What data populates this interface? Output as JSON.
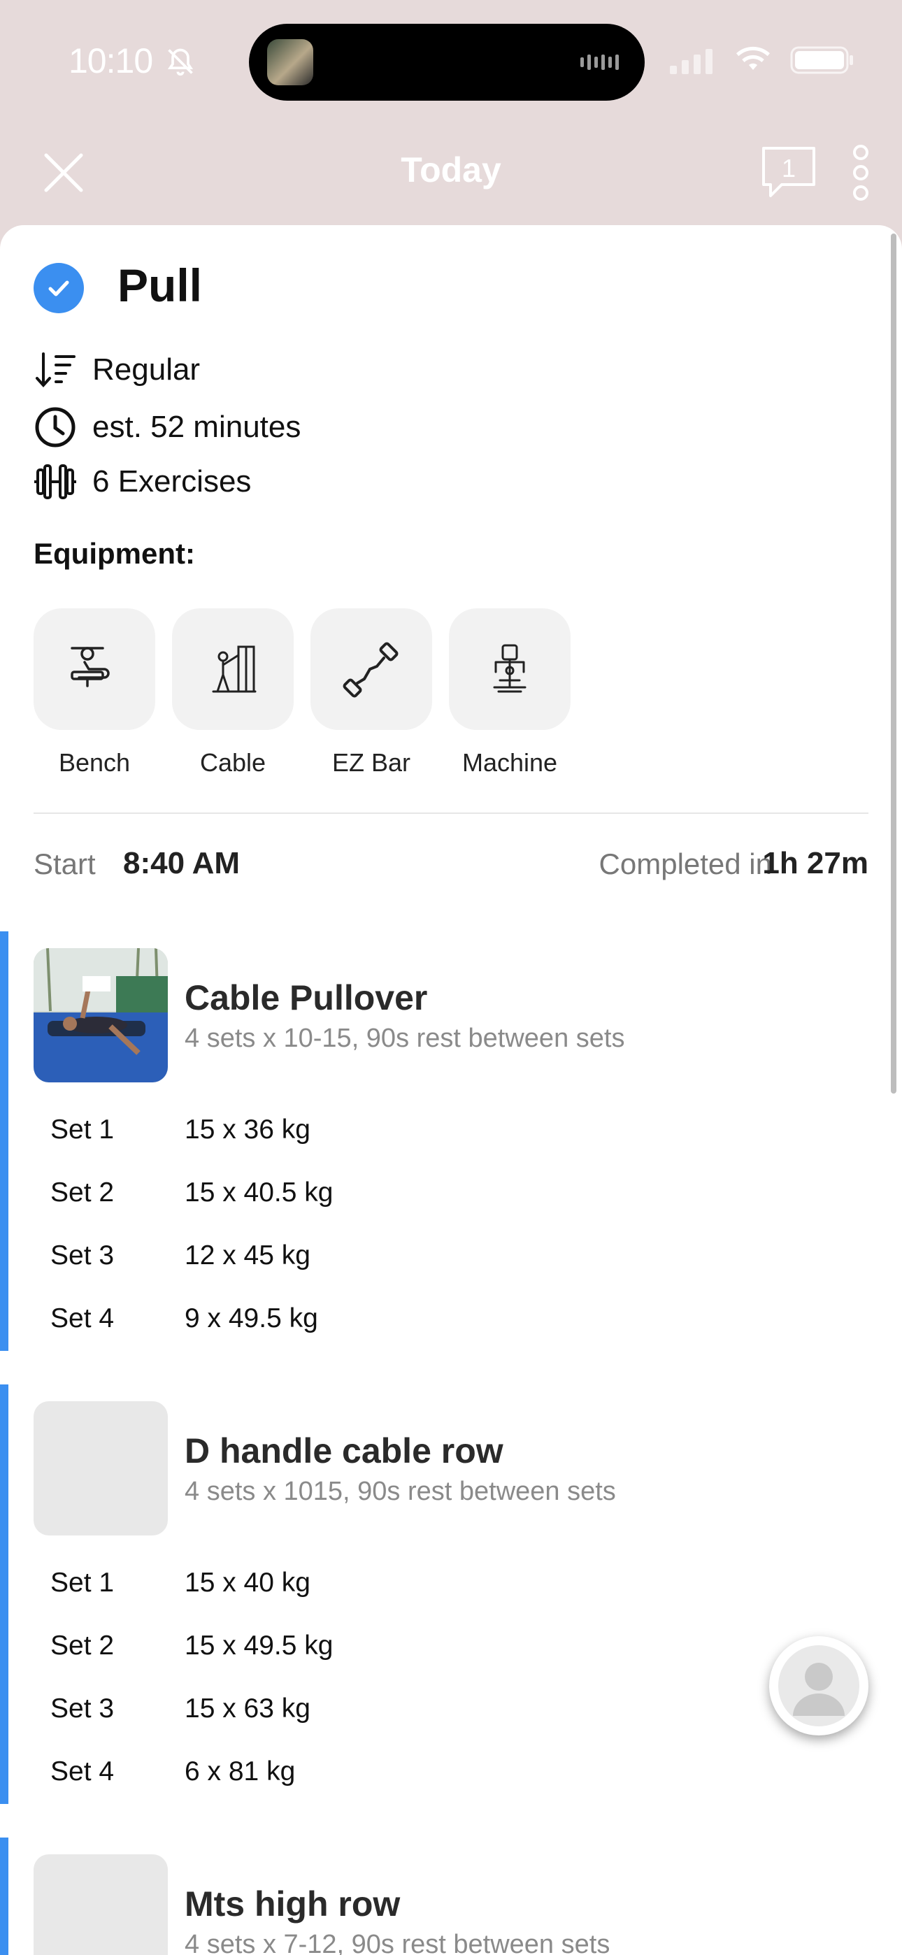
{
  "status_bar": {
    "time": "10:10"
  },
  "nav": {
    "title": "Today",
    "chat_count": "1"
  },
  "workout": {
    "title": "Pull",
    "meta": [
      {
        "icon": "sort-icon",
        "text": "Regular"
      },
      {
        "icon": "clock-icon",
        "text": "est. 52 minutes"
      },
      {
        "icon": "dumbbell-icon",
        "text": "6 Exercises"
      }
    ],
    "equipment_label": "Equipment:",
    "equipment": [
      {
        "icon": "bench-icon",
        "label": "Bench"
      },
      {
        "icon": "cable-icon",
        "label": "Cable"
      },
      {
        "icon": "ez-bar-icon",
        "label": "EZ Bar"
      },
      {
        "icon": "machine-icon",
        "label": "Machine"
      }
    ],
    "start_label": "Start",
    "start_time": "8:40 AM",
    "completed_label": "Completed in",
    "completed_time": "1h 27m"
  },
  "exercises": [
    {
      "name": "Cable Pullover",
      "summary": "4 sets x 10-15, 90s rest between sets",
      "sets": [
        {
          "label": "Set 1",
          "value": "15 x 36 kg"
        },
        {
          "label": "Set 2",
          "value": "15 x 40.5 kg"
        },
        {
          "label": "Set 3",
          "value": "12 x 45 kg"
        },
        {
          "label": "Set 4",
          "value": "9 x 49.5 kg"
        }
      ]
    },
    {
      "name": "D handle cable row",
      "summary": "4 sets x 1015, 90s rest between sets",
      "sets": [
        {
          "label": "Set 1",
          "value": "15 x 40 kg"
        },
        {
          "label": "Set 2",
          "value": "15 x 49.5 kg"
        },
        {
          "label": "Set 3",
          "value": "15 x 63 kg"
        },
        {
          "label": "Set 4",
          "value": "6 x 81 kg"
        }
      ]
    },
    {
      "name": "Mts high row",
      "summary": "4 sets x 7-12, 90s rest between sets",
      "sets": []
    }
  ],
  "colors": {
    "accent": "#3b8ff0",
    "header_bg": "#e6dada"
  }
}
